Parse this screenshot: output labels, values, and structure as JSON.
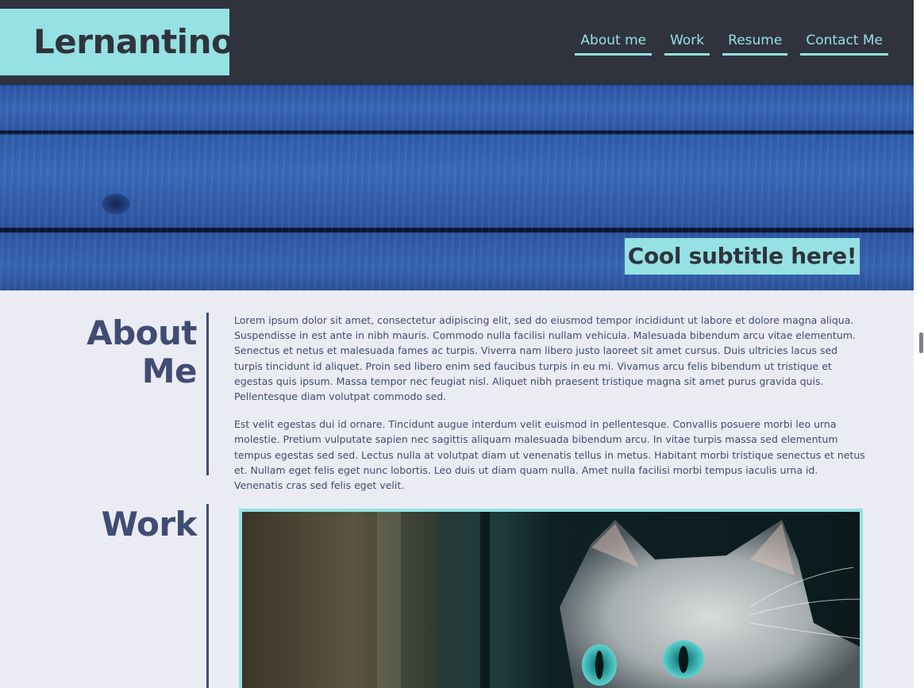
{
  "header": {
    "logo": "Lernantino",
    "nav": [
      "About me",
      "Work",
      "Resume",
      "Contact Me"
    ]
  },
  "hero": {
    "subtitle": "Cool subtitle here!"
  },
  "about": {
    "title_line1": "About",
    "title_line2": "Me",
    "paragraphs": [
      "Lorem ipsum dolor sit amet, consectetur adipiscing elit, sed do eiusmod tempor incididunt ut labore et dolore magna aliqua. Suspendisse in est ante in nibh mauris. Commodo nulla facilisi nullam vehicula. Malesuada bibendum arcu vitae elementum. Senectus et netus et malesuada fames ac turpis. Viverra nam libero justo laoreet sit amet cursus. Duis ultricies lacus sed turpis tincidunt id aliquet. Proin sed libero enim sed faucibus turpis in eu mi. Vivamus arcu felis bibendum ut tristique et egestas quis ipsum. Massa tempor nec feugiat nisl. Aliquet nibh praesent tristique magna sit amet purus gravida quis. Pellentesque diam volutpat commodo sed.",
      "Est velit egestas dui id ornare. Tincidunt augue interdum velit euismod in pellentesque. Convallis posuere morbi leo urna molestie. Pretium vulputate sapien nec sagittis aliquam malesuada bibendum arcu. In vitae turpis massa sed elementum tempus egestas sed sed. Lectus nulla at volutpat diam ut venenatis tellus in metus. Habitant morbi tristique senectus et netus et. Nullam eget felis eget nunc lobortis. Leo duis ut diam quam nulla. Amet nulla facilisi morbi tempus iaculis urna id. Venenatis cras sed felis eget velit."
    ]
  },
  "work": {
    "title": "Work"
  },
  "colors": {
    "dark": "#30333d",
    "accent": "#95e1e3",
    "text": "#3f4c73",
    "background": "#ebebf3"
  }
}
